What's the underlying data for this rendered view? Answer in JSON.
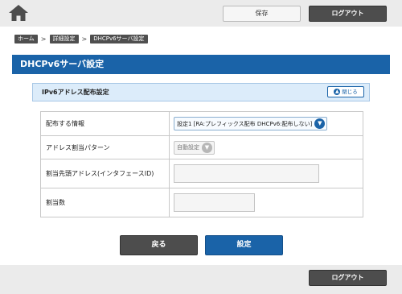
{
  "header": {
    "home_icon": "home-icon",
    "save_label": "保存",
    "logout_label": "ログアウト"
  },
  "breadcrumb": {
    "items": [
      "ホーム",
      "詳細設定",
      "DHCPv6サーバ設定"
    ],
    "separator": ">"
  },
  "page": {
    "title": "DHCPv6サーバ設定"
  },
  "section": {
    "title": "IPv6アドレス配布設定",
    "close_label": "閉じる"
  },
  "settings": {
    "rows": [
      {
        "label": "配布する情報",
        "value": "設定1 [RA:プレフィックス配布 DHCPv6:配布しない]"
      },
      {
        "label": "アドレス割当パターン",
        "value": "自動設定"
      },
      {
        "label": "割当先頭アドレス(インタフェースID)",
        "value": ""
      },
      {
        "label": "割当数",
        "value": ""
      }
    ]
  },
  "actions": {
    "back_label": "戻る",
    "apply_label": "設定"
  },
  "footer": {
    "logout_label": "ログアウト"
  },
  "colors": {
    "accent": "#1a63a8",
    "dark_button": "#4d4d4d",
    "bar_background": "#ebebeb",
    "section_background": "#dcecfa"
  }
}
